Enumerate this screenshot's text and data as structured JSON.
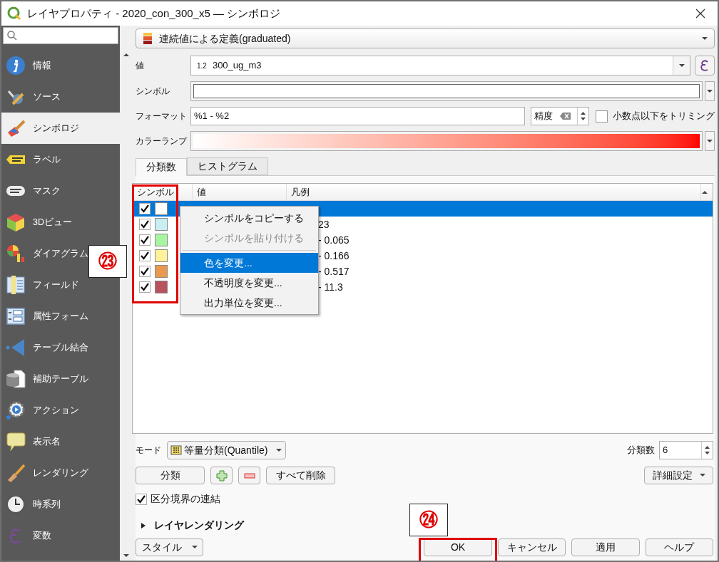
{
  "window": {
    "title": "レイヤプロパティ - 2020_con_300_x5 — シンボロジ"
  },
  "sidebar": {
    "items": [
      {
        "label": "情報",
        "selected": false
      },
      {
        "label": "ソース",
        "selected": false
      },
      {
        "label": "シンボロジ",
        "selected": true
      },
      {
        "label": "ラベル",
        "selected": false
      },
      {
        "label": "マスク",
        "selected": false
      },
      {
        "label": "3Dビュー",
        "selected": false
      },
      {
        "label": "ダイアグラム",
        "selected": false
      },
      {
        "label": "フィールド",
        "selected": false
      },
      {
        "label": "属性フォーム",
        "selected": false
      },
      {
        "label": "テーブル結合",
        "selected": false
      },
      {
        "label": "補助テーブル",
        "selected": false
      },
      {
        "label": "アクション",
        "selected": false
      },
      {
        "label": "表示名",
        "selected": false
      },
      {
        "label": "レンダリング",
        "selected": false
      },
      {
        "label": "時系列",
        "selected": false
      },
      {
        "label": "変数",
        "selected": false
      }
    ]
  },
  "renderer": "連続値による定義(graduated)",
  "form": {
    "value_label": "値",
    "value_type": "1.2",
    "value": "300_ug_m3",
    "symbol_label": "シンボル",
    "format_label": "フォーマット",
    "format": "%1 - %2",
    "precision": "精度",
    "trim_label": "小数点以下をトリミング",
    "trim_checked": false,
    "color_ramp_label": "カラーランプ"
  },
  "tabs": [
    {
      "label": "分類数",
      "selected": true
    },
    {
      "label": "ヒストグラム",
      "selected": false
    }
  ],
  "table": {
    "columns": [
      "シンボル",
      "値",
      "凡例"
    ],
    "rows": [
      {
        "checked": true,
        "color": "#ffffff",
        "selected": true
      },
      {
        "checked": true,
        "color": "#c8eef2",
        "legend": "23",
        "selected": false
      },
      {
        "checked": true,
        "color": "#a8f4a0",
        "legend": "- 0.065",
        "selected": false
      },
      {
        "checked": true,
        "color": "#fff29a",
        "legend": "- 0.166",
        "selected": false
      },
      {
        "checked": true,
        "color": "#e8994f",
        "legend": "- 0.517",
        "selected": false
      },
      {
        "checked": true,
        "color": "#b9525f",
        "legend": "- 11.3",
        "selected": false
      }
    ]
  },
  "context_menu": {
    "items": [
      {
        "kind": "item",
        "label": "シンボルをコピーする",
        "disabled": false,
        "selected": false
      },
      {
        "kind": "item",
        "label": "シンボルを貼り付ける",
        "disabled": true,
        "selected": false
      },
      {
        "kind": "separator"
      },
      {
        "kind": "item",
        "label": "色を変更...",
        "disabled": false,
        "selected": true
      },
      {
        "kind": "item",
        "label": "不透明度を変更...",
        "disabled": false,
        "selected": false
      },
      {
        "kind": "item",
        "label": "出力単位を変更...",
        "disabled": false,
        "selected": false
      }
    ]
  },
  "mode": {
    "label": "モード",
    "value": "等量分類(Quantile)",
    "classes_label": "分類数",
    "classes": "6"
  },
  "actions": {
    "classify": "分類",
    "delete_all": "すべて削除",
    "advanced": "詳細設定"
  },
  "link_boundaries": {
    "label": "区分境界の連結",
    "checked": true
  },
  "layer_rendering": {
    "label": "レイヤレンダリング",
    "expanded": false
  },
  "footer": {
    "style": "スタイル",
    "buttons": [
      "OK",
      "キャンセル",
      "適用",
      "ヘルプ"
    ]
  },
  "annotations": [
    {
      "text": "㉓"
    },
    {
      "text": "㉔"
    }
  ]
}
